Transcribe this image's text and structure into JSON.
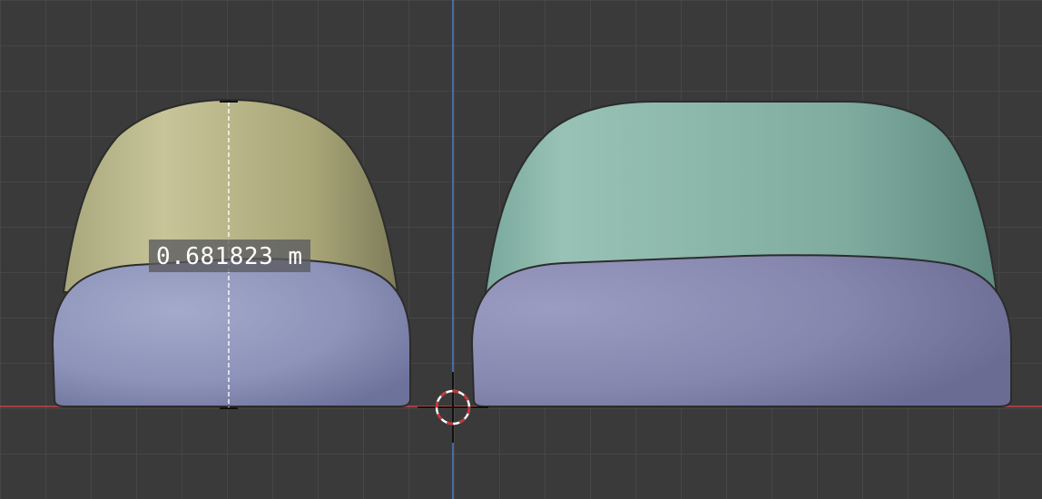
{
  "viewport": {
    "background": "#3a3a3a",
    "grid_color": "#4a4a4a",
    "x_axis_color": "#c8404a",
    "z_axis_color": "#4a78c0"
  },
  "measurement": {
    "value": "0.681823 m"
  },
  "objects": {
    "left_top_color": "#bcb98c",
    "left_bottom_color": "#8a92b8",
    "right_top_color": "#84b4a8",
    "right_bottom_color": "#8688b0"
  },
  "cursor": {
    "icon": "3d-cursor-icon"
  }
}
